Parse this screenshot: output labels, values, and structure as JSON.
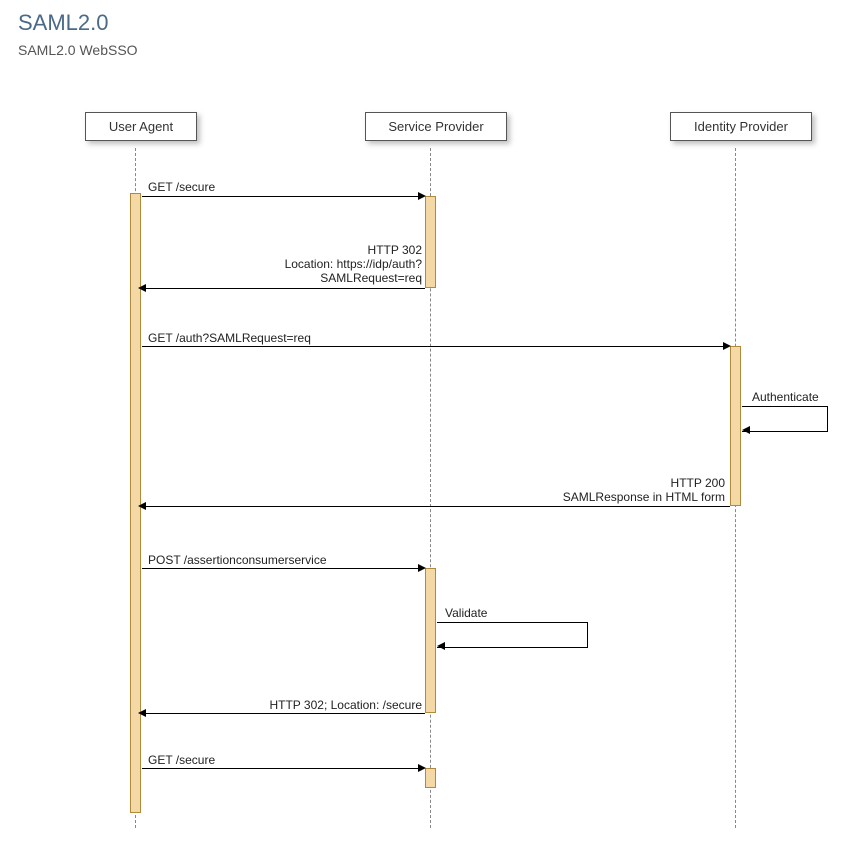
{
  "title": "SAML2.0",
  "subtitle": "SAML2.0 WebSSO",
  "participants": {
    "ua": "User Agent",
    "sp": "Service Provider",
    "idp": "Identity Provider"
  },
  "messages": {
    "m1": "GET /secure",
    "m2": "HTTP 302\nLocation: https://idp/auth?\nSAMLRequest=req",
    "m3": "GET /auth?SAMLRequest=req",
    "m4": "Authenticate",
    "m5": "HTTP 200\nSAMLResponse in HTML form",
    "m6": "POST /assertionconsumerservice",
    "m7": "Validate",
    "m8": "HTTP 302; Location: /secure",
    "m9": "GET /secure"
  }
}
